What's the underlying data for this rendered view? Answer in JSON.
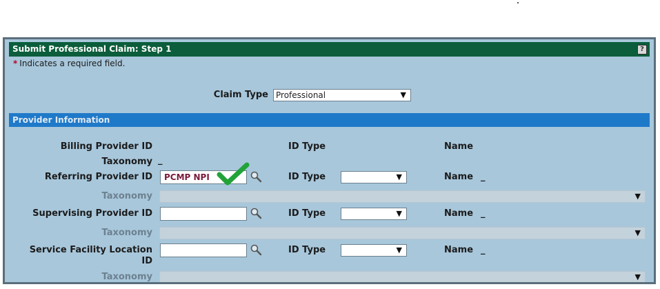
{
  "panel": {
    "title": "Submit Professional Claim: Step 1",
    "help_icon": "help-icon",
    "required_note": "Indicates a required field.",
    "required_star": "*"
  },
  "claim_type": {
    "label": "Claim Type",
    "value": "Professional"
  },
  "provider_section": {
    "title": "Provider Information",
    "columns": {
      "id_type": "ID Type",
      "name": "Name"
    },
    "billing": {
      "label": "Billing Provider ID",
      "taxonomy_label": "Taxonomy",
      "taxonomy_value": "_"
    },
    "referring": {
      "label": "Referring Provider ID",
      "id_value": "PCMP NPI",
      "id_type_label": "ID Type",
      "name_label": "Name",
      "name_value": "_",
      "taxonomy_label": "Taxonomy"
    },
    "supervising": {
      "label": "Supervising Provider ID",
      "id_type_label": "ID Type",
      "name_label": "Name",
      "name_value": "_",
      "taxonomy_label": "Taxonomy"
    },
    "service_facility": {
      "label_line1": "Service Facility Location",
      "label_line2": "ID",
      "id_type_label": "ID Type",
      "name_label": "Name",
      "name_value": "_",
      "taxonomy_label": "Taxonomy"
    }
  },
  "icons": {
    "search": "magnifier-icon",
    "dropdown": "chevron-down-icon",
    "check": "checkmark-icon"
  },
  "colors": {
    "title_bar": "#0b5d3b",
    "section_bar": "#1f79c9",
    "panel_bg": "#a8c7db",
    "required_star": "#c0002a",
    "check": "#22a33a"
  }
}
